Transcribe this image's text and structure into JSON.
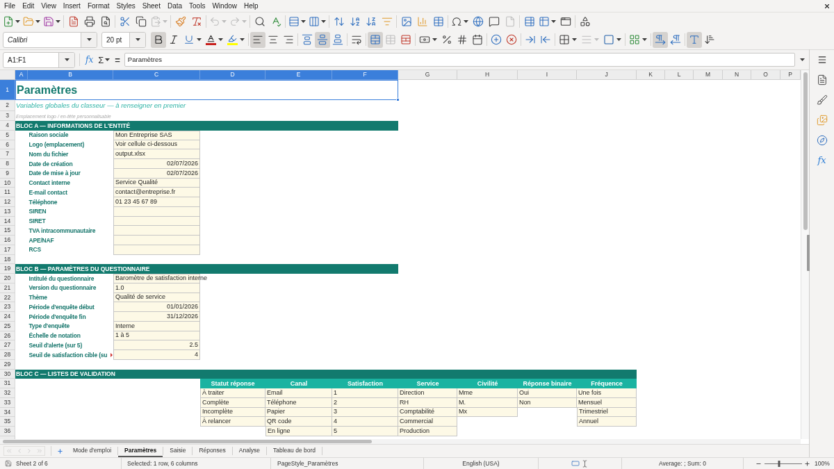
{
  "menu": [
    "File",
    "Edit",
    "View",
    "Insert",
    "Format",
    "Styles",
    "Sheet",
    "Data",
    "Tools",
    "Window",
    "Help"
  ],
  "standard_toolbar": {
    "paste": {
      "disabled": true
    },
    "undo": {
      "disabled": true
    },
    "redo": {
      "disabled": true
    },
    "header_footer": {
      "disabled": true
    }
  },
  "formatting_toolbar": {
    "font_name": "Calibri",
    "font_size": "20 pt",
    "bold": {
      "on": true
    },
    "italic": {
      "on": false
    },
    "underline": {
      "on": false
    },
    "align_left": {
      "on": true
    },
    "align_center": {
      "on": false
    },
    "align_right": {
      "on": false
    },
    "align_top": {
      "on": false
    },
    "align_middle": {
      "on": true
    },
    "align_bottom": {
      "on": false
    },
    "wrap_text": {
      "on": false
    },
    "merge_and_center": {
      "on": true
    },
    "merge_cells": {
      "disabled": true
    },
    "border_style": {
      "disabled": true
    },
    "left_to_right": {
      "on": true
    },
    "right_to_left": {
      "on": false
    },
    "text_direction": {
      "on": true
    },
    "stacked_text": {
      "on": false
    }
  },
  "formula_bar": {
    "name_box": "A1:F1",
    "function_wizard": "fx",
    "sum": "Σ",
    "formula": "=",
    "content": "Paramètres"
  },
  "sidebar": {
    "functions": "fx"
  },
  "sheet": {
    "columns": [
      {
        "label": "A",
        "selected": true
      },
      {
        "label": "B",
        "selected": true
      },
      {
        "label": "C",
        "selected": true
      },
      {
        "label": "D",
        "selected": true
      },
      {
        "label": "E",
        "selected": true
      },
      {
        "label": "F",
        "selected": true
      },
      {
        "label": "G",
        "selected": false
      },
      {
        "label": "H",
        "selected": false
      },
      {
        "label": "I",
        "selected": false
      },
      {
        "label": "J",
        "selected": false
      },
      {
        "label": "K",
        "selected": false
      },
      {
        "label": "L",
        "selected": false
      },
      {
        "label": "M",
        "selected": false
      },
      {
        "label": "N",
        "selected": false
      },
      {
        "label": "O",
        "selected": false
      },
      {
        "label": "P",
        "selected": false
      }
    ],
    "row_headers": [
      {
        "label": "1",
        "selected": true
      },
      {
        "label": "2",
        "selected": false
      },
      {
        "label": "3",
        "selected": false
      },
      {
        "label": "4",
        "selected": false
      },
      {
        "label": "5",
        "selected": false
      },
      {
        "label": "6",
        "selected": false
      },
      {
        "label": "7",
        "selected": false
      },
      {
        "label": "8",
        "selected": false
      },
      {
        "label": "9",
        "selected": false
      },
      {
        "label": "10",
        "selected": false
      },
      {
        "label": "11",
        "selected": false
      },
      {
        "label": "12",
        "selected": false
      },
      {
        "label": "13",
        "selected": false
      },
      {
        "label": "14",
        "selected": false
      },
      {
        "label": "15",
        "selected": false
      },
      {
        "label": "16",
        "selected": false
      },
      {
        "label": "17",
        "selected": false
      },
      {
        "label": "18",
        "selected": false
      },
      {
        "label": "19",
        "selected": false
      },
      {
        "label": "20",
        "selected": false
      },
      {
        "label": "21",
        "selected": false
      },
      {
        "label": "22",
        "selected": false
      },
      {
        "label": "23",
        "selected": false
      },
      {
        "label": "24",
        "selected": false
      },
      {
        "label": "25",
        "selected": false
      },
      {
        "label": "26",
        "selected": false
      },
      {
        "label": "27",
        "selected": false
      },
      {
        "label": "28",
        "selected": false
      },
      {
        "label": "29",
        "selected": false
      },
      {
        "label": "30",
        "selected": false
      },
      {
        "label": "31",
        "selected": false
      },
      {
        "label": "32",
        "selected": false
      },
      {
        "label": "33",
        "selected": false
      },
      {
        "label": "34",
        "selected": false
      },
      {
        "label": "35",
        "selected": false
      },
      {
        "label": "36",
        "selected": false
      }
    ],
    "title": {
      "text": "Paramètres",
      "selected": true
    },
    "subtitle": "Variables globales du classeur — à renseigner en premier",
    "note": "Emplacement logo / en-tête personnalisable",
    "blocks": [
      {
        "kind": "fields",
        "title": "BLOC A — INFORMATIONS DE L'ENTITÉ",
        "fields": [
          {
            "label": "Raison sociale",
            "value": "Mon Entreprise SAS",
            "kind": "text",
            "label_overflow": false
          },
          {
            "label": "Logo (emplacement)",
            "value": "Voir cellule ci-dessous",
            "kind": "text",
            "label_overflow": false
          },
          {
            "label": "Nom du fichier",
            "value": "output.xlsx",
            "kind": "text",
            "label_overflow": false
          },
          {
            "label": "Date de création",
            "value": "02/07/2026",
            "kind": "date",
            "label_overflow": false
          },
          {
            "label": "Date de mise à jour",
            "value": "02/07/2026",
            "kind": "date",
            "label_overflow": false
          },
          {
            "label": "Contact interne",
            "value": "Service Qualité",
            "kind": "text",
            "label_overflow": false
          },
          {
            "label": "E-mail contact",
            "value": "contact@entreprise.fr",
            "kind": "text",
            "label_overflow": false
          },
          {
            "label": "Téléphone",
            "value": "01 23 45 67 89",
            "kind": "text",
            "label_overflow": false
          },
          {
            "label": "SIREN",
            "kind": "text",
            "label_overflow": false
          },
          {
            "label": "SIRET",
            "kind": "text",
            "label_overflow": false
          },
          {
            "label": "TVA intracommunautaire",
            "kind": "text",
            "label_overflow": false
          },
          {
            "label": "APE/NAF",
            "kind": "text",
            "label_overflow": false
          },
          {
            "label": "RCS",
            "kind": "text",
            "label_overflow": false
          }
        ]
      },
      {
        "kind": "fields",
        "title": "BLOC B — PARAMÈTRES DU QUESTIONNAIRE",
        "fields": [
          {
            "label": "Intitulé du questionnaire",
            "value": "Baromètre de satisfaction interne",
            "kind": "text",
            "label_overflow": false
          },
          {
            "label": "Version du questionnaire",
            "value": "1.0",
            "kind": "text",
            "label_overflow": false
          },
          {
            "label": "Thème",
            "value": "Qualité de service",
            "kind": "text",
            "label_overflow": false
          },
          {
            "label": "Période d'enquête début",
            "value": "01/01/2026",
            "kind": "date",
            "label_overflow": false
          },
          {
            "label": "Période d'enquête fin",
            "value": "31/12/2026",
            "kind": "date",
            "label_overflow": false
          },
          {
            "label": "Type d'enquête",
            "value": "Interne",
            "kind": "text",
            "label_overflow": false
          },
          {
            "label": "Échelle de notation",
            "value": "1 à 5",
            "kind": "text",
            "label_overflow": false
          },
          {
            "label": "Seuil d'alerte (sur 5)",
            "value": "2.5",
            "kind": "number",
            "label_overflow": false
          },
          {
            "label": "Seuil de satisfaction cible (su",
            "value": "4",
            "kind": "number",
            "label_overflow": true
          }
        ]
      },
      {
        "kind": "lists",
        "title": "BLOC C — LISTES DE VALIDATION",
        "lists": [
          {
            "header": "Statut réponse",
            "items": [
              "À traiter",
              "Complète",
              "Incomplète",
              "À relancer"
            ]
          },
          {
            "header": "Canal",
            "items": [
              "Email",
              "Téléphone",
              "Papier",
              "QR code",
              "En ligne"
            ]
          },
          {
            "header": "Satisfaction",
            "items": [
              "1",
              "2",
              "3",
              "4",
              "5"
            ]
          },
          {
            "header": "Service",
            "items": [
              "Direction",
              "RH",
              "Comptabilité",
              "Commercial",
              "Production"
            ]
          },
          {
            "header": "Civilité",
            "items": [
              "Mme",
              "M.",
              "Mx"
            ]
          },
          {
            "header": "Réponse binaire",
            "items": [
              "Oui",
              "Non"
            ]
          },
          {
            "header": "Fréquence",
            "items": [
              "Une fois",
              "Mensuel",
              "Trimestriel",
              "Annuel"
            ]
          }
        ]
      }
    ]
  },
  "sheet_tabs": {
    "navigation_disabled": true,
    "tabs": [
      {
        "label": "Mode d'emploi",
        "selected": false
      },
      {
        "label": "Paramètres",
        "selected": true
      },
      {
        "label": "Saisie",
        "selected": false
      },
      {
        "label": "Réponses",
        "selected": false
      },
      {
        "label": "Analyse",
        "selected": false
      },
      {
        "label": "Tableau de bord",
        "selected": false
      }
    ]
  },
  "status_bar": {
    "sheet": "Sheet 2 of 6",
    "selection": "Selected: 1 row, 6 columns",
    "page_style": "PageStyle_Paramètres",
    "language": "English (USA)",
    "summary": "Average: ; Sum: 0",
    "zoom": {
      "level": 0.38,
      "reading": "100%"
    }
  }
}
